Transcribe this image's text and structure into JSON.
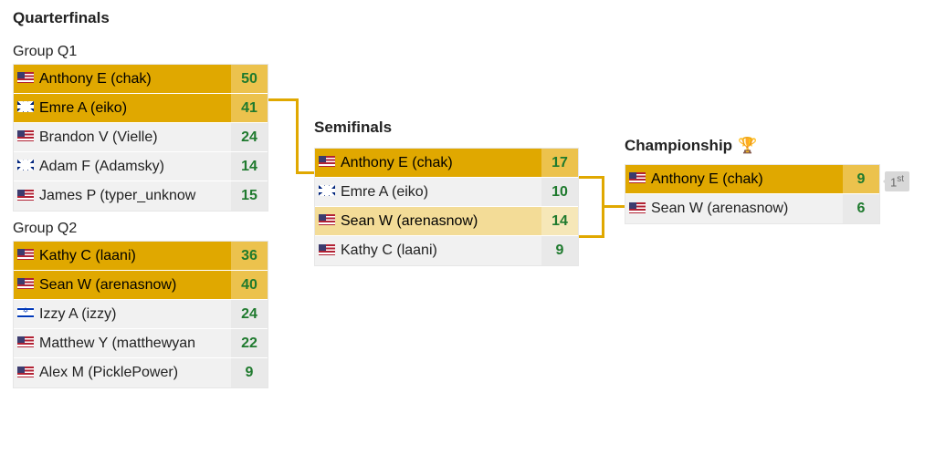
{
  "stages": {
    "qf_title": "Quarterfinals",
    "sf_title": "Semifinals",
    "ch_title": "Championship"
  },
  "groups": {
    "q1_title": "Group Q1",
    "q2_title": "Group Q2"
  },
  "q1": [
    {
      "flag": "us",
      "name": "Anthony E (chak)",
      "score": "50",
      "style": "gold"
    },
    {
      "flag": "uk",
      "name": "Emre A (eiko)",
      "score": "41",
      "style": "gold"
    },
    {
      "flag": "us",
      "name": "Brandon V (Vielle)",
      "score": "24",
      "style": "plain"
    },
    {
      "flag": "uk",
      "name": "Adam F (Adamsky)",
      "score": "14",
      "style": "plain"
    },
    {
      "flag": "us",
      "name": "James P (typer_unknow",
      "score": "15",
      "style": "plain"
    }
  ],
  "q2": [
    {
      "flag": "us",
      "name": "Kathy C (laani)",
      "score": "36",
      "style": "gold"
    },
    {
      "flag": "us",
      "name": "Sean W (arenasnow)",
      "score": "40",
      "style": "gold"
    },
    {
      "flag": "il",
      "name": "Izzy A (izzy)",
      "score": "24",
      "style": "plain"
    },
    {
      "flag": "us",
      "name": "Matthew Y (matthewyan",
      "score": "22",
      "style": "plain"
    },
    {
      "flag": "us",
      "name": "Alex M (PicklePower)",
      "score": "9",
      "style": "plain"
    }
  ],
  "sf": [
    {
      "flag": "us",
      "name": "Anthony E (chak)",
      "score": "17",
      "style": "gold"
    },
    {
      "flag": "uk",
      "name": "Emre A (eiko)",
      "score": "10",
      "style": "plain"
    },
    {
      "flag": "us",
      "name": "Sean W (arenasnow)",
      "score": "14",
      "style": "lightgold"
    },
    {
      "flag": "us",
      "name": "Kathy C (laani)",
      "score": "9",
      "style": "plain"
    }
  ],
  "ch": [
    {
      "flag": "us",
      "name": "Anthony E (chak)",
      "score": "9",
      "style": "gold"
    },
    {
      "flag": "us",
      "name": "Sean W (arenasnow)",
      "score": "6",
      "style": "plain"
    }
  ],
  "place_tag": "1",
  "place_tag_suffix": "st",
  "trophy": "🏆"
}
